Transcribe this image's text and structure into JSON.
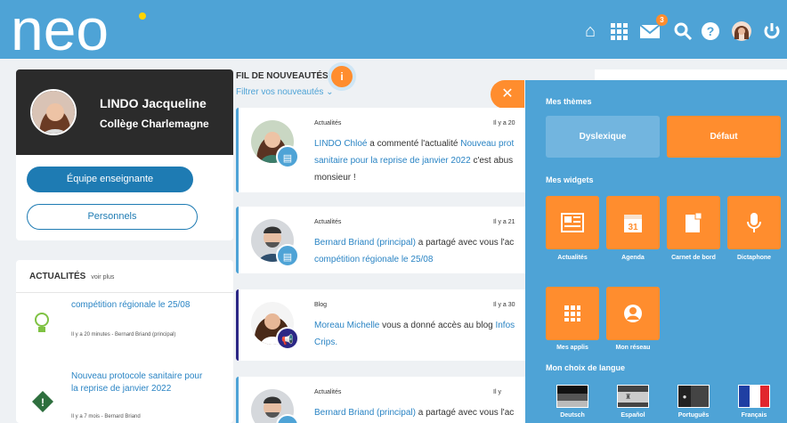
{
  "logo": "neo",
  "header_icons": [
    "home-icon",
    "apps-grid-icon",
    "mail-icon",
    "search-icon",
    "help-icon",
    "user-avatar",
    "power-icon"
  ],
  "notifications": {
    "mail_count": "3"
  },
  "colors": {
    "header": "#4ea3d6",
    "accent": "#ff8d2e",
    "link": "#2a84c4",
    "primary_button": "#1e7bb3",
    "blog": "#2b2785"
  },
  "profile": {
    "name": "LINDO Jacqueline",
    "school": "Collège Charlemagne",
    "team_button": "Équipe enseignante",
    "personal_button": "Personnels"
  },
  "actualites": {
    "title": "ACTUALITÉS",
    "more": "voir plus",
    "items": [
      {
        "title": "compétition régionale le 25/08",
        "meta": "Il y a 20 minutes - Bernard Briand (principal)"
      },
      {
        "title": "Nouveau protocole sanitaire pour la reprise de janvier 2022",
        "meta": "Il y a 7 mois - Bernard Briand"
      }
    ]
  },
  "feed": {
    "title": "FIL DE NOUVEAUTÉS",
    "filter": "Filtrer vos nouveautés",
    "items": [
      {
        "type": "Actualités",
        "time": "Il y a 20",
        "author": "LINDO Chloé",
        "action": " a commenté l'actualité ",
        "link": "Nouveau prot",
        "text2": "sanitaire pour la reprise de janvier 2022",
        "rest": " c'est abus",
        "line3": "monsieur !"
      },
      {
        "type": "Actualités",
        "time": "Il y a 21",
        "author": "Bernard Briand (principal)",
        "action": " a partagé avec vous l'ac",
        "line2": "compétition régionale le 25/08"
      },
      {
        "type": "Blog",
        "time": "Il y a 30",
        "author": "Moreau Michelle",
        "action": " vous a donné accès au blog ",
        "link": "Infos",
        "line2": "Crips."
      },
      {
        "type": "Actualités",
        "time": "Il y",
        "author": "Bernard Briand (principal)",
        "action": " a partagé avec vous l'ac"
      }
    ]
  },
  "panel": {
    "themes_title": "Mes thèmes",
    "themes": [
      "Dyslexique",
      "Défaut"
    ],
    "widgets_title": "Mes widgets",
    "widgets": [
      {
        "label": "Actualités",
        "icon": "newspaper-icon"
      },
      {
        "label": "Agenda",
        "icon": "calendar-icon",
        "day": "31"
      },
      {
        "label": "Carnet de bord",
        "icon": "notebook-icon"
      },
      {
        "label": "Dictaphone",
        "icon": "microphone-icon"
      },
      {
        "label": "Mes applis",
        "icon": "apps-grid-icon"
      },
      {
        "label": "Mon réseau",
        "icon": "user-circle-icon"
      }
    ],
    "language_title": "Mon choix de langue",
    "languages": [
      "Deutsch",
      "Español",
      "Português",
      "Français"
    ]
  }
}
